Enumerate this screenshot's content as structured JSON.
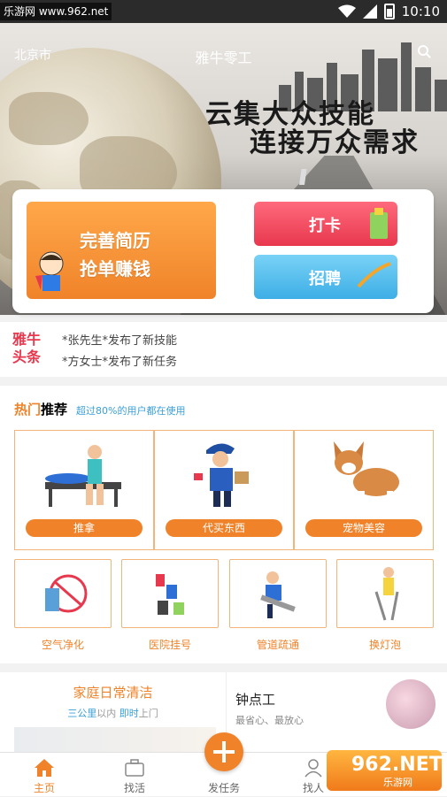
{
  "status_bar": {
    "site": "乐游网 www.962.net",
    "time": "10:10"
  },
  "header": {
    "city": "北京市",
    "title": "雅牛零工"
  },
  "banner": {
    "slogan_line1": "云集大众技能",
    "slogan_line2": "连接万众需求"
  },
  "actions": {
    "resume_line1": "完善简历",
    "resume_line2": "抢单赚钱",
    "checkin": "打卡",
    "recruit": "招聘"
  },
  "headlines": {
    "logo_line1": "雅牛",
    "logo_line2": "头条",
    "items": [
      "*张先生*发布了新技能",
      "*方女士*发布了新任务"
    ]
  },
  "hot": {
    "title_a": "热门",
    "title_b": "推荐",
    "subtitle": "超过80%的用户都在使用",
    "large": [
      "推拿",
      "代买东西",
      "宠物美容"
    ],
    "small": [
      "空气净化",
      "医院挂号",
      "管道疏通",
      "换灯泡"
    ]
  },
  "cleaning": {
    "title": "家庭日常清洁",
    "sub_a": "三公里",
    "sub_b": "以内",
    "sub_c": "即时",
    "sub_d": "上门"
  },
  "hourly": {
    "title": "钟点工",
    "subtitle": "最省心、最放心"
  },
  "tabs": {
    "home": "主页",
    "find_job": "找活",
    "post_task": "发任务",
    "find_people": "找人"
  },
  "watermark": {
    "big": "962.NET",
    "small": "乐游网"
  },
  "colors": {
    "accent": "#f0832a",
    "red": "#e8384e",
    "blue": "#3daee6"
  }
}
